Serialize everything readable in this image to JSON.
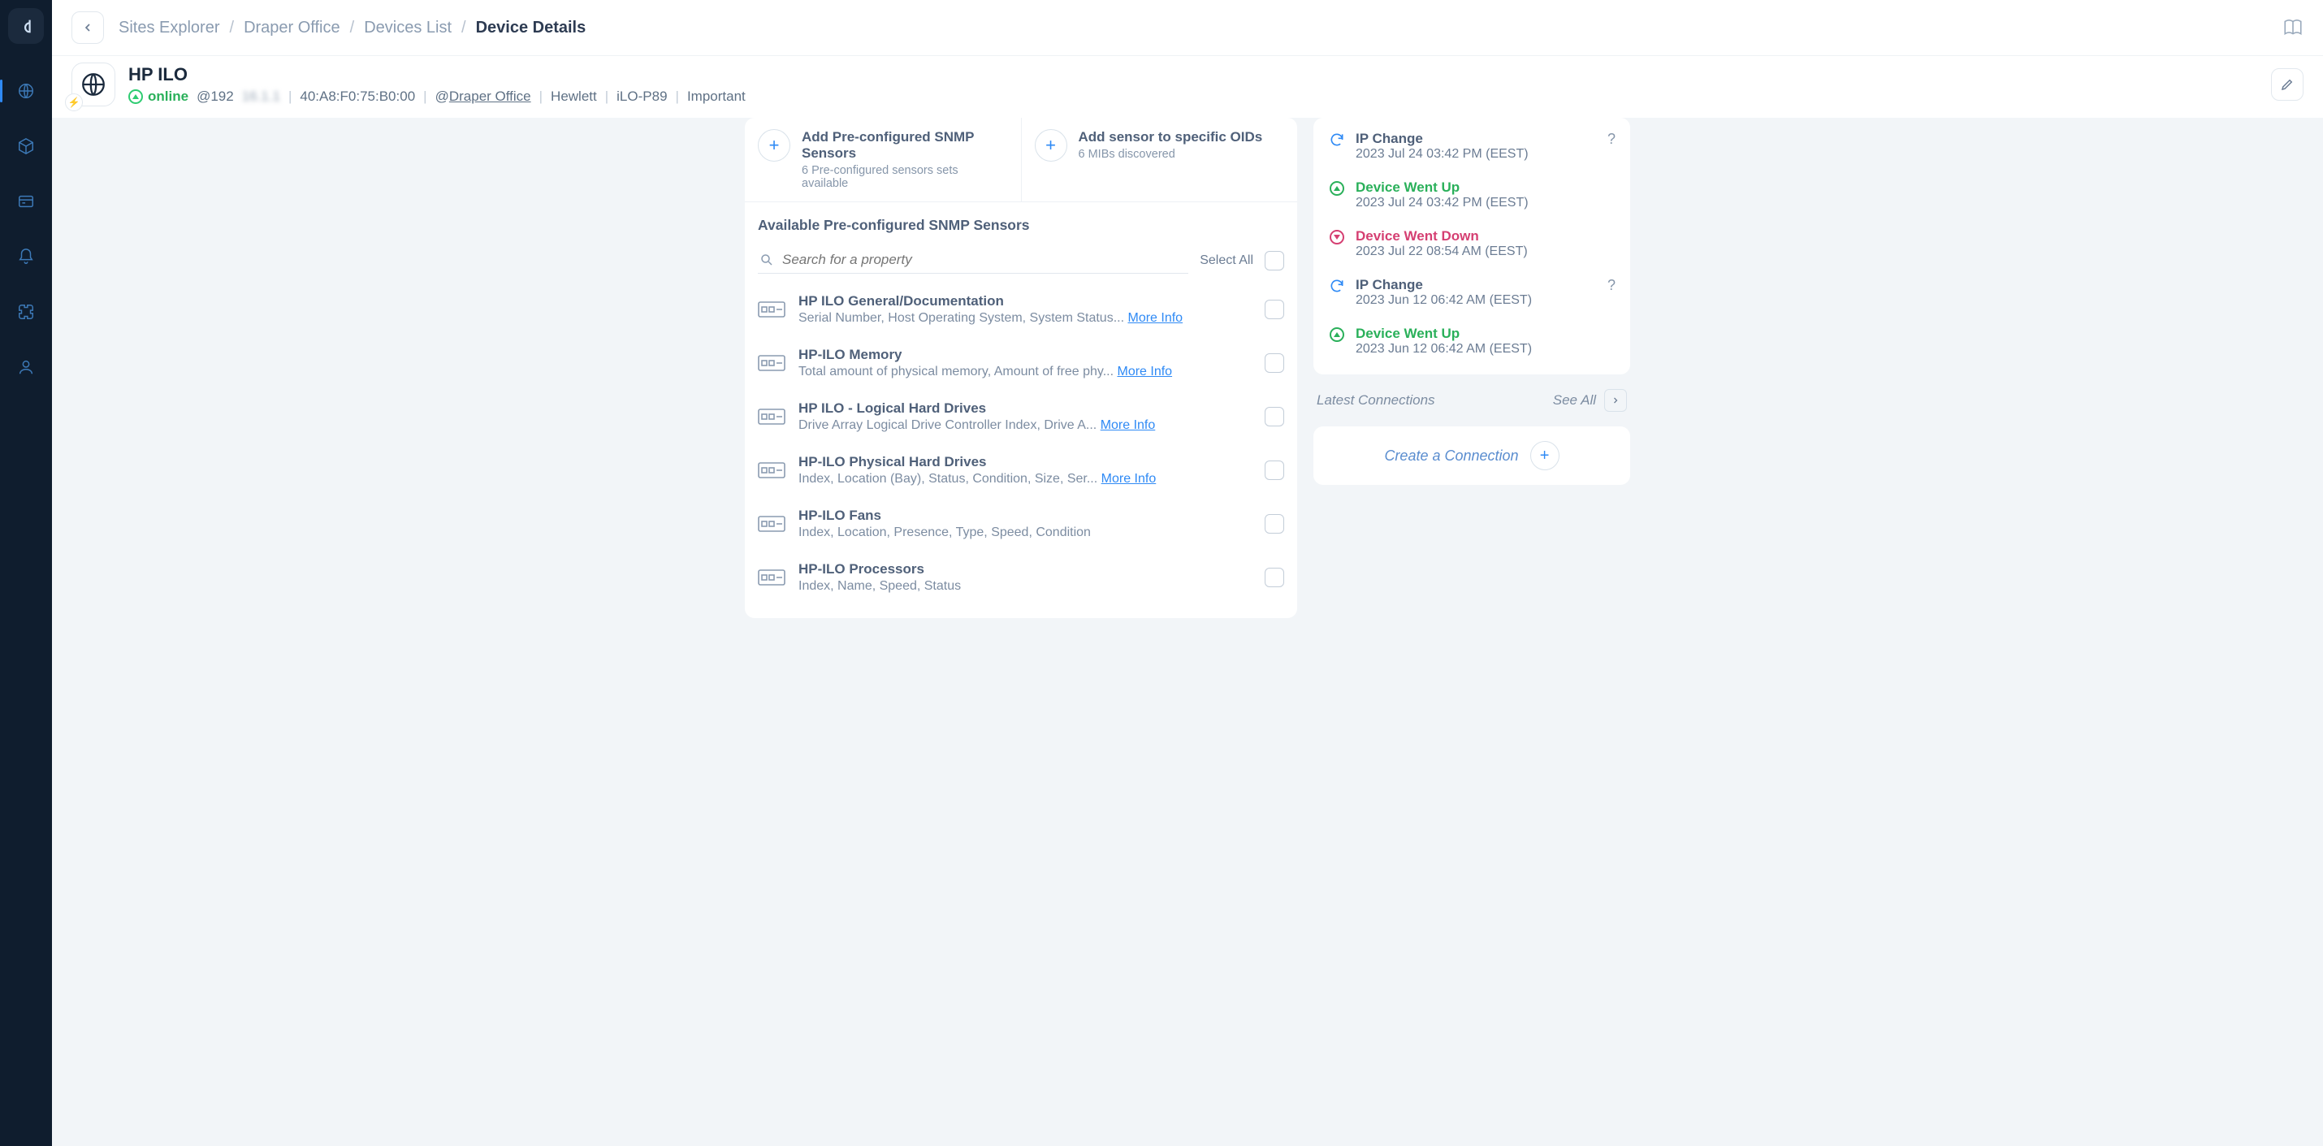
{
  "breadcrumb": {
    "items": [
      "Sites Explorer",
      "Draper Office",
      "Devices List",
      "Device Details"
    ]
  },
  "device": {
    "name": "HP ILO",
    "status": "online",
    "ip_prefix": "@192",
    "ip_masked": "16.1.1",
    "mac": "40:A8:F0:75:B0:00",
    "site_prefix": "@",
    "site": "Draper Office",
    "vendor": "Hewlett",
    "model": "iLO-P89",
    "importance": "Important"
  },
  "actions": {
    "preconfigured": {
      "title": "Add Pre-configured SNMP Sensors",
      "sub": "6 Pre-configured sensors sets available"
    },
    "oids": {
      "title": "Add sensor to specific OIDs",
      "sub": "6 MIBs discovered"
    }
  },
  "sensors_section": {
    "title": "Available Pre-configured SNMP Sensors",
    "search_placeholder": "Search for a property",
    "select_all": "Select All",
    "more_info": "More Info",
    "items": [
      {
        "name": "HP ILO General/Documentation",
        "desc": "Serial Number, Host Operating System, System Status... ",
        "has_more": true
      },
      {
        "name": "HP-ILO Memory",
        "desc": "Total amount of physical memory, Amount of free phy... ",
        "has_more": true
      },
      {
        "name": "HP ILO - Logical Hard Drives",
        "desc": "Drive Array Logical Drive Controller Index, Drive A... ",
        "has_more": true
      },
      {
        "name": "HP-ILO Physical Hard Drives",
        "desc": "Index, Location (Bay), Status, Condition, Size, Ser... ",
        "has_more": true
      },
      {
        "name": "HP-ILO Fans",
        "desc": "Index, Location, Presence, Type, Speed, Condition",
        "has_more": false
      },
      {
        "name": "HP-ILO Processors",
        "desc": "Index, Name, Speed, Status",
        "has_more": false
      }
    ]
  },
  "timeline": [
    {
      "kind": "change",
      "title": "IP Change",
      "date": "2023 Jul 24 03:42 PM (EEST)",
      "help": true
    },
    {
      "kind": "up",
      "title": "Device Went Up",
      "date": "2023 Jul 24 03:42 PM (EEST)",
      "help": false
    },
    {
      "kind": "down",
      "title": "Device Went Down",
      "date": "2023 Jul 22 08:54 AM (EEST)",
      "help": false
    },
    {
      "kind": "change",
      "title": "IP Change",
      "date": "2023 Jun 12 06:42 AM (EEST)",
      "help": true
    },
    {
      "kind": "up",
      "title": "Device Went Up",
      "date": "2023 Jun 12 06:42 AM (EEST)",
      "help": false
    }
  ],
  "connections": {
    "header": "Latest Connections",
    "see_all": "See All",
    "create": "Create a Connection"
  }
}
